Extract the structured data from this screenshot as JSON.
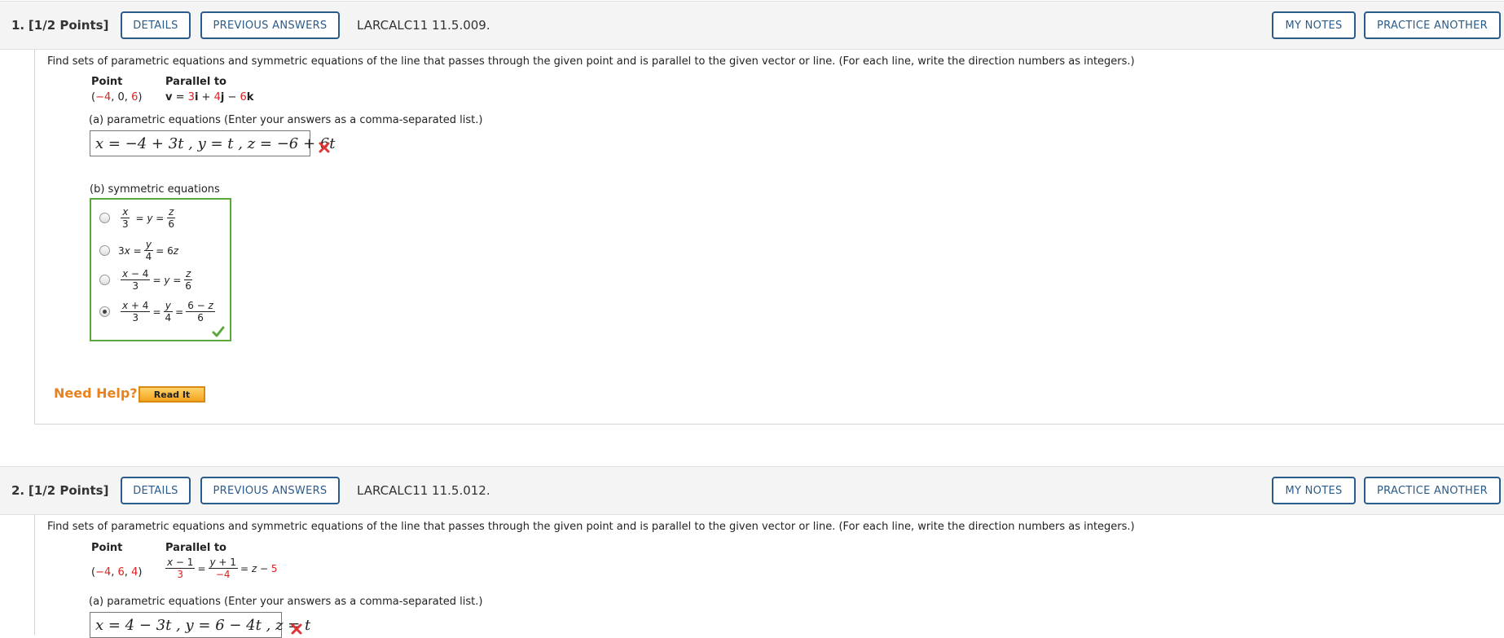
{
  "q1": {
    "number": "1.",
    "points": "[1/2 Points]",
    "details_label": "DETAILS",
    "previous_answers_label": "PREVIOUS ANSWERS",
    "code": "LARCALC11 11.5.009.",
    "my_notes_label": "MY NOTES",
    "practice_another_label": "PRACTICE ANOTHER",
    "prompt": "Find sets of parametric equations and symmetric equations of the line that passes through the given point and is parallel to the given vector or line. (For each line, write the direction numbers as integers.)",
    "point_header": "Point",
    "parallel_header": "Parallel to",
    "point_value": "(−4, 0, 6)",
    "parallel_value": "v = 3i + 4j − 6k",
    "part_a_label": "(a) parametric equations (Enter your answers as a comma-separated list.)",
    "part_a_answer": "x = −4 + 3t , y = t , z = −6 + 6t",
    "part_a_status": "incorrect",
    "part_b_label": "(b) symmetric equations",
    "part_b_options": [
      "x/3 = y = z/6",
      "3x = y/4 = 6z",
      "(x − 4)/3 = y = z/6",
      "(x + 4)/3 = y/4 = (6 − z)/6"
    ],
    "part_b_selected": 3,
    "part_b_status": "correct",
    "need_help_label": "Need Help?",
    "read_it_label": "Read It"
  },
  "q2": {
    "number": "2.",
    "points": "[1/2 Points]",
    "details_label": "DETAILS",
    "previous_answers_label": "PREVIOUS ANSWERS",
    "code": "LARCALC11 11.5.012.",
    "my_notes_label": "MY NOTES",
    "practice_another_label": "PRACTICE ANOTHER",
    "prompt": "Find sets of parametric equations and symmetric equations of the line that passes through the given point and is parallel to the given vector or line. (For each line, write the direction numbers as integers.)",
    "point_header": "Point",
    "parallel_header": "Parallel to",
    "point_value": "(−4, 6, 4)",
    "parallel_value": "(x − 1)/3 = (y + 1)/(−4) = z − 5",
    "part_a_label": "(a) parametric equations (Enter your answers as a comma-separated list.)",
    "part_a_answer": "x = 4 − 3t , y = 6 − 4t , z = t",
    "part_a_status": "incorrect"
  },
  "colors": {
    "accent_blue": "#2a5b8a",
    "given_red": "#d22222",
    "correct_green": "#5aa83c",
    "help_orange": "#e8821e"
  }
}
